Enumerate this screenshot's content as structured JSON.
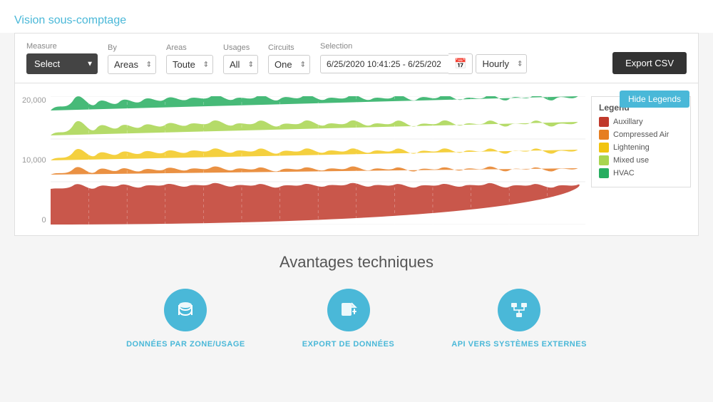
{
  "page": {
    "title": "Vision sous-comptage"
  },
  "controls": {
    "measure_label": "Measure",
    "measure_value": "Select",
    "by_label": "By",
    "by_value": "Areas",
    "areas_label": "Areas",
    "areas_value": "Toute",
    "usages_label": "Usages",
    "usages_value": "All",
    "circuits_label": "Circuits",
    "circuits_value": "One",
    "selection_label": "Selection",
    "date_value": "6/25/2020 10:41:25 - 6/25/202",
    "hourly_value": "Hourly",
    "export_label": "Export CSV"
  },
  "chart": {
    "hide_legends_label": "Hide Legends",
    "y_axis": [
      "20,000",
      "10,000",
      "0"
    ],
    "legend": {
      "title": "Legend",
      "items": [
        {
          "label": "Auxillary",
          "color": "#c0392b"
        },
        {
          "label": "Compressed Air",
          "color": "#e67e22"
        },
        {
          "label": "Lightening",
          "color": "#f1c40f"
        },
        {
          "label": "Mixed use",
          "color": "#a8d54f"
        },
        {
          "label": "HVAC",
          "color": "#27ae60"
        }
      ]
    }
  },
  "avantages": {
    "title": "Avantages techniques",
    "features": [
      {
        "label": "DONNÉES PAR ZONE/USAGE",
        "icon": "database"
      },
      {
        "label": "EXPORT DE DONNÉES",
        "icon": "export"
      },
      {
        "label": "API VERS SYSTÈMES EXTERNES",
        "icon": "api"
      }
    ]
  }
}
